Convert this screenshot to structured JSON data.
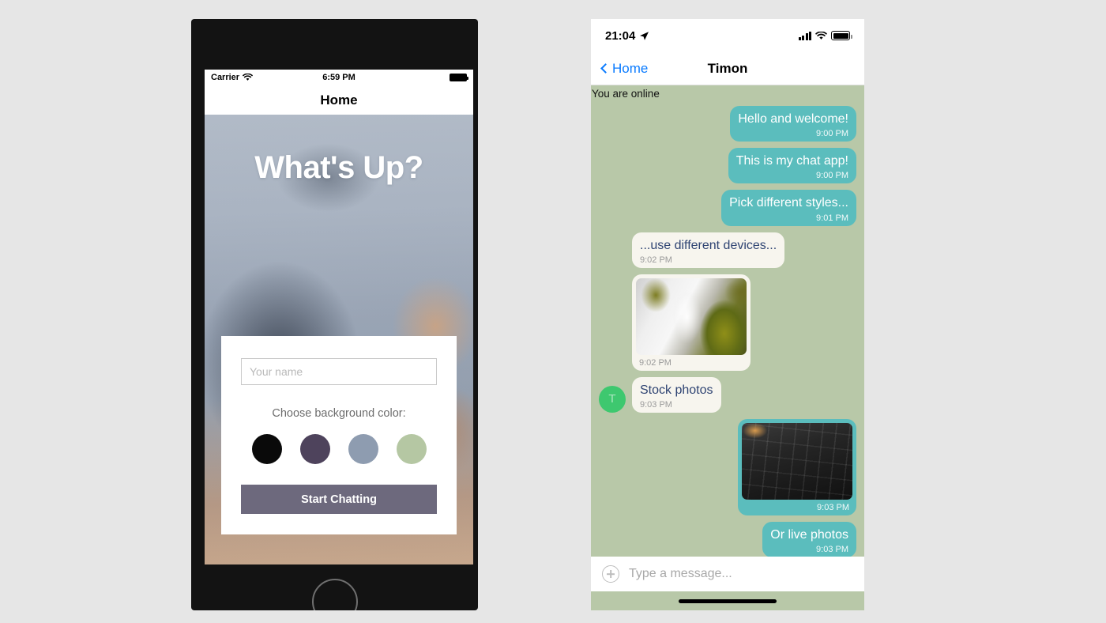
{
  "colors": {
    "page_background": "#e6e6e6",
    "phone_frame": "#131313",
    "chat_background": "#b8c8a8",
    "bubble_out": "#5bbdbd",
    "bubble_in": "#f7f5ee",
    "bubble_in_text": "#2e4372",
    "accent_blue": "#0a7bff",
    "avatar_green": "#3ec86f",
    "start_button": "#6d697d"
  },
  "left_phone": {
    "status_bar": {
      "carrier": "Carrier",
      "wifi_icon": "wifi-icon",
      "time": "6:59 PM",
      "battery_icon": "battery-icon"
    },
    "navbar": {
      "title": "Home"
    },
    "hero": {
      "title": "What's Up?"
    },
    "form": {
      "name_placeholder": "Your name",
      "name_value": "",
      "choose_color_label": "Choose background color:",
      "swatches": [
        {
          "name": "black",
          "hex": "#0a0a0a"
        },
        {
          "name": "dark-purple",
          "hex": "#4e435c"
        },
        {
          "name": "slate-blue",
          "hex": "#8e9cb0"
        },
        {
          "name": "sage-green",
          "hex": "#b5c7a3"
        }
      ],
      "start_button": "Start Chatting"
    }
  },
  "right_phone": {
    "status_bar": {
      "time": "21:04",
      "location_icon": "location-arrow-icon",
      "signal_icon": "cellular-signal-icon",
      "wifi_icon": "wifi-icon",
      "battery_icon": "battery-icon"
    },
    "navbar": {
      "back_label": "Home",
      "back_icon": "chevron-left-icon",
      "title": "Timon"
    },
    "online_status": "You are online",
    "avatar_initial": "T",
    "messages": [
      {
        "direction": "out",
        "type": "text",
        "text": "Hello and welcome!",
        "time": "9:00 PM"
      },
      {
        "direction": "out",
        "type": "text",
        "text": "This is my chat app!",
        "time": "9:00 PM"
      },
      {
        "direction": "out",
        "type": "text",
        "text": "Pick different styles...",
        "time": "9:01 PM"
      },
      {
        "direction": "in",
        "type": "text",
        "text": "...use different devices...",
        "time": "9:02 PM"
      },
      {
        "direction": "in",
        "type": "image",
        "image": "waterfall-photo",
        "time": "9:02 PM"
      },
      {
        "direction": "in",
        "type": "text",
        "text": "Stock photos",
        "time": "9:03 PM",
        "avatar": true
      },
      {
        "direction": "out",
        "type": "image",
        "image": "keyboard-photo",
        "time": "9:03 PM"
      },
      {
        "direction": "out",
        "type": "text",
        "text": "Or live photos",
        "time": "9:03 PM"
      }
    ],
    "input_bar": {
      "add_icon": "plus-circle-icon",
      "placeholder": "Type a message...",
      "value": ""
    }
  }
}
